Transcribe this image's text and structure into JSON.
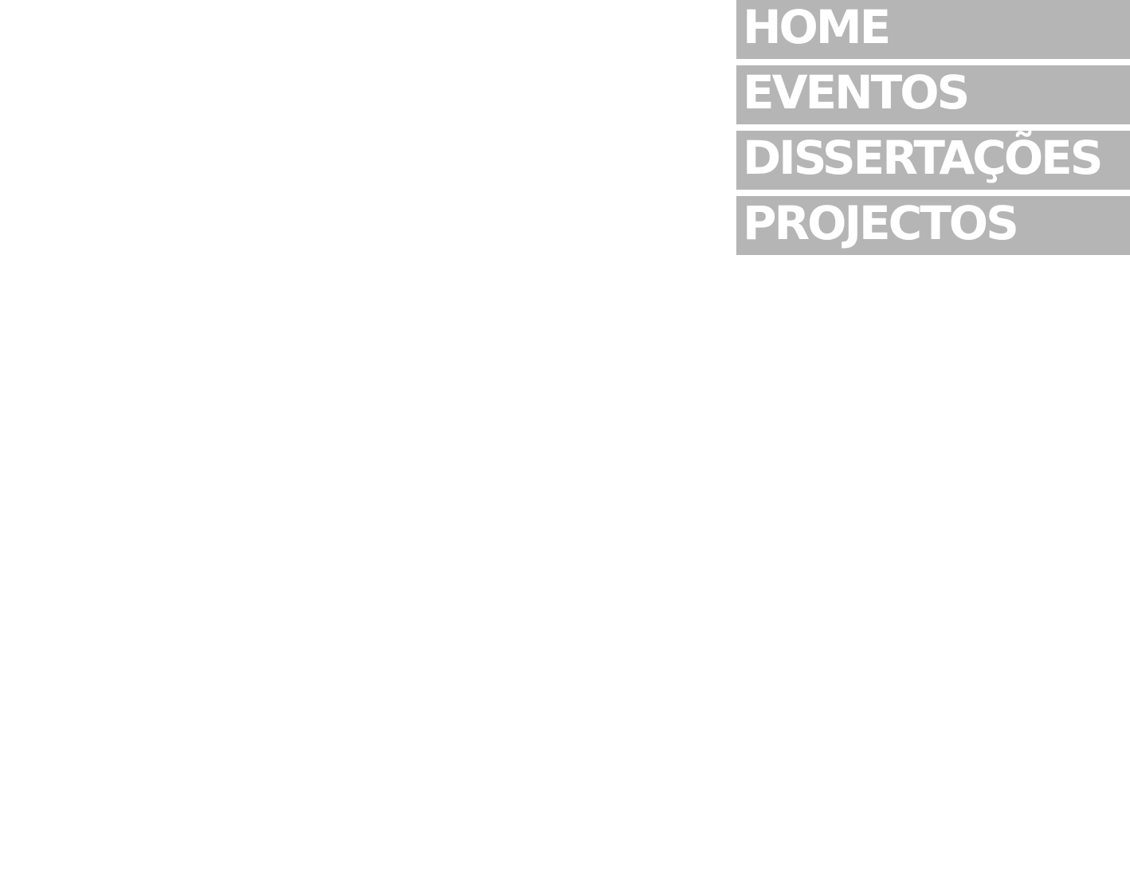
{
  "nav": {
    "items": [
      {
        "label": "HOME"
      },
      {
        "label": "EVENTOS"
      },
      {
        "label": "DISSERTAÇÕES"
      },
      {
        "label": "PROJECTOS"
      }
    ]
  },
  "colors": {
    "background": "#ffffff",
    "nav_item_background": "#b5b5b5",
    "nav_item_text": "#ffffff"
  }
}
